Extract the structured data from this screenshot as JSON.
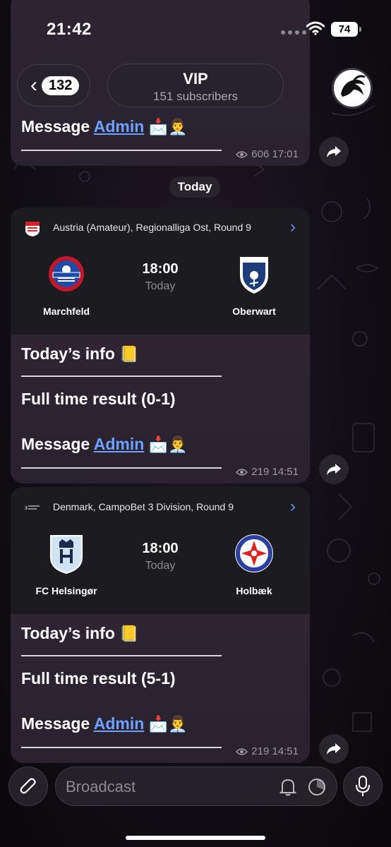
{
  "status_bar": {
    "time": "21:42",
    "battery": "74"
  },
  "header": {
    "back_count": "132",
    "channel_title": "VIP",
    "subscribers": "151 subscribers"
  },
  "messages": [
    {
      "message_prefix": "Message",
      "admin_link": "Admin",
      "views_time": "606 17:01"
    },
    {
      "competition": "Austria (Amateur), Regionalliga Ost, Round 9",
      "home_team": "Marchfeld",
      "away_team": "Oberwart",
      "kickoff_time": "18:00",
      "kickoff_day": "Today",
      "info_title": "Today’s info",
      "result": "Full time result (0-1)",
      "message_prefix": "Message",
      "admin_link": "Admin",
      "views_time": "219 14:51"
    },
    {
      "competition": "Denmark, CampoBet 3 Division, Round 9",
      "home_team": "FC Helsingør",
      "away_team": "Holbæk",
      "kickoff_time": "18:00",
      "kickoff_day": "Today",
      "info_title": "Today’s info",
      "result": "Full time result (5-1)",
      "message_prefix": "Message",
      "admin_link": "Admin",
      "views_time": "219 14:51"
    }
  ],
  "date_separator": "Today",
  "composer": {
    "placeholder": "Broadcast"
  },
  "icons": [
    "back-chevron-icon",
    "eye-icon",
    "forward-icon",
    "chevron-right-icon",
    "attach-icon",
    "bell-icon",
    "timer-icon",
    "mic-icon",
    "wifi-icon",
    "envelope-icon",
    "person-icon",
    "notebook-icon"
  ]
}
